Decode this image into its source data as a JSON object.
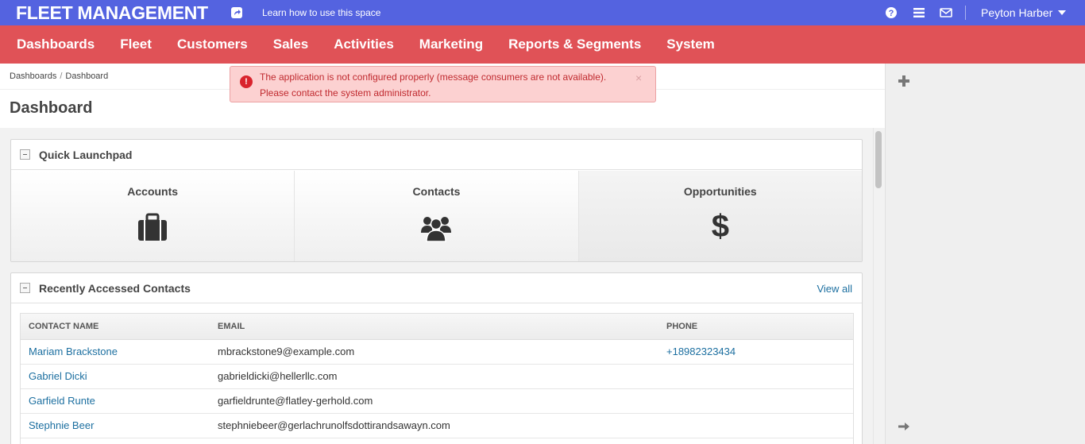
{
  "topbar": {
    "brand": "FLEET MANAGEMENT",
    "learn_link": "Learn how to use this space",
    "user_name": "Peyton Harber",
    "icons": [
      "share-icon",
      "help-icon",
      "list-icon",
      "mail-icon",
      "caret-down-icon"
    ]
  },
  "nav": {
    "items": [
      "Dashboards",
      "Fleet",
      "Customers",
      "Sales",
      "Activities",
      "Marketing",
      "Reports & Segments",
      "System"
    ]
  },
  "breadcrumb": [
    "Dashboards",
    "Dashboard"
  ],
  "page_title": "Dashboard",
  "alert": {
    "text": "The application is not configured properly (message consumers are not available). Please contact the system administrator.",
    "close": "×"
  },
  "quick_launchpad": {
    "title": "Quick Launchpad",
    "items": [
      {
        "label": "Accounts",
        "icon": "briefcase-icon"
      },
      {
        "label": "Contacts",
        "icon": "users-icon"
      },
      {
        "label": "Opportunities",
        "icon": "dollar-icon",
        "glyph": "$"
      }
    ]
  },
  "recent_contacts": {
    "title": "Recently Accessed Contacts",
    "view_all": "View all",
    "columns": [
      "CONTACT NAME",
      "EMAIL",
      "PHONE"
    ],
    "rows": [
      [
        "Mariam Brackstone",
        "mbrackstone9@example.com",
        "+18982323434"
      ],
      [
        "Gabriel Dicki",
        "gabrieldicki@hellerllc.com",
        ""
      ],
      [
        "Garfield Runte",
        "garfieldrunte@flatley-gerhold.com",
        ""
      ],
      [
        "Stephnie Beer",
        "stephniebeer@gerlachrunolfsdottirandsawayn.com",
        ""
      ],
      [
        "",
        "",
        ""
      ]
    ]
  },
  "colors": {
    "topbar": "#5463e0",
    "nav": "#e05257",
    "link": "#1c6fa0",
    "alert_bg": "#fcd1d1",
    "alert_text": "#c02a2f"
  }
}
